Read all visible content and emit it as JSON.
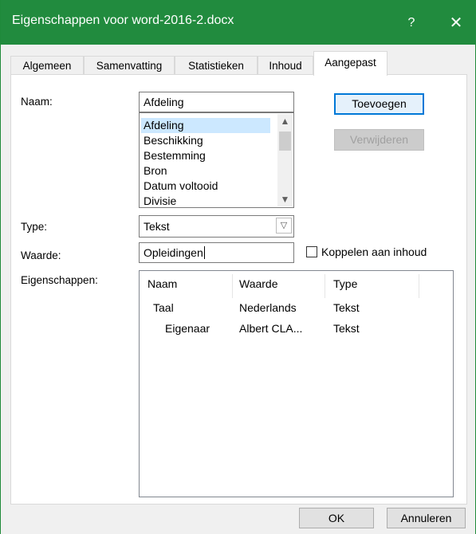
{
  "window": {
    "title": "Eigenschappen voor word-2016-2.docx",
    "help_glyph": "?",
    "close_glyph": "✕",
    "accent": "#218b3e"
  },
  "tabs": [
    {
      "label": "Algemeen"
    },
    {
      "label": "Samenvatting"
    },
    {
      "label": "Statistieken"
    },
    {
      "label": "Inhoud"
    },
    {
      "label": "Aangepast",
      "active": true
    }
  ],
  "form": {
    "name_label": "Naam:",
    "name_value": "Afdeling",
    "name_list": [
      "Afdeling",
      "Beschikking",
      "Bestemming",
      "Bron",
      "Datum voltooid",
      "Divisie"
    ],
    "add_button": "Toevoegen",
    "remove_button": "Verwijderen",
    "type_label": "Type:",
    "type_value": "Tekst",
    "value_label": "Waarde:",
    "value_value": "Opleidingen",
    "link_label": "Koppelen aan inhoud",
    "link_checked": false,
    "properties_label": "Eigenschappen:"
  },
  "properties": {
    "columns": [
      "Naam",
      "Waarde",
      "Type"
    ],
    "rows": [
      {
        "name": "Taal",
        "value": "Nederlands",
        "type": "Tekst"
      },
      {
        "name": "Eigenaar",
        "value": "Albert CLA...",
        "type": "Tekst"
      }
    ]
  },
  "footer": {
    "ok_button": "OK",
    "cancel_button": "Annuleren"
  }
}
